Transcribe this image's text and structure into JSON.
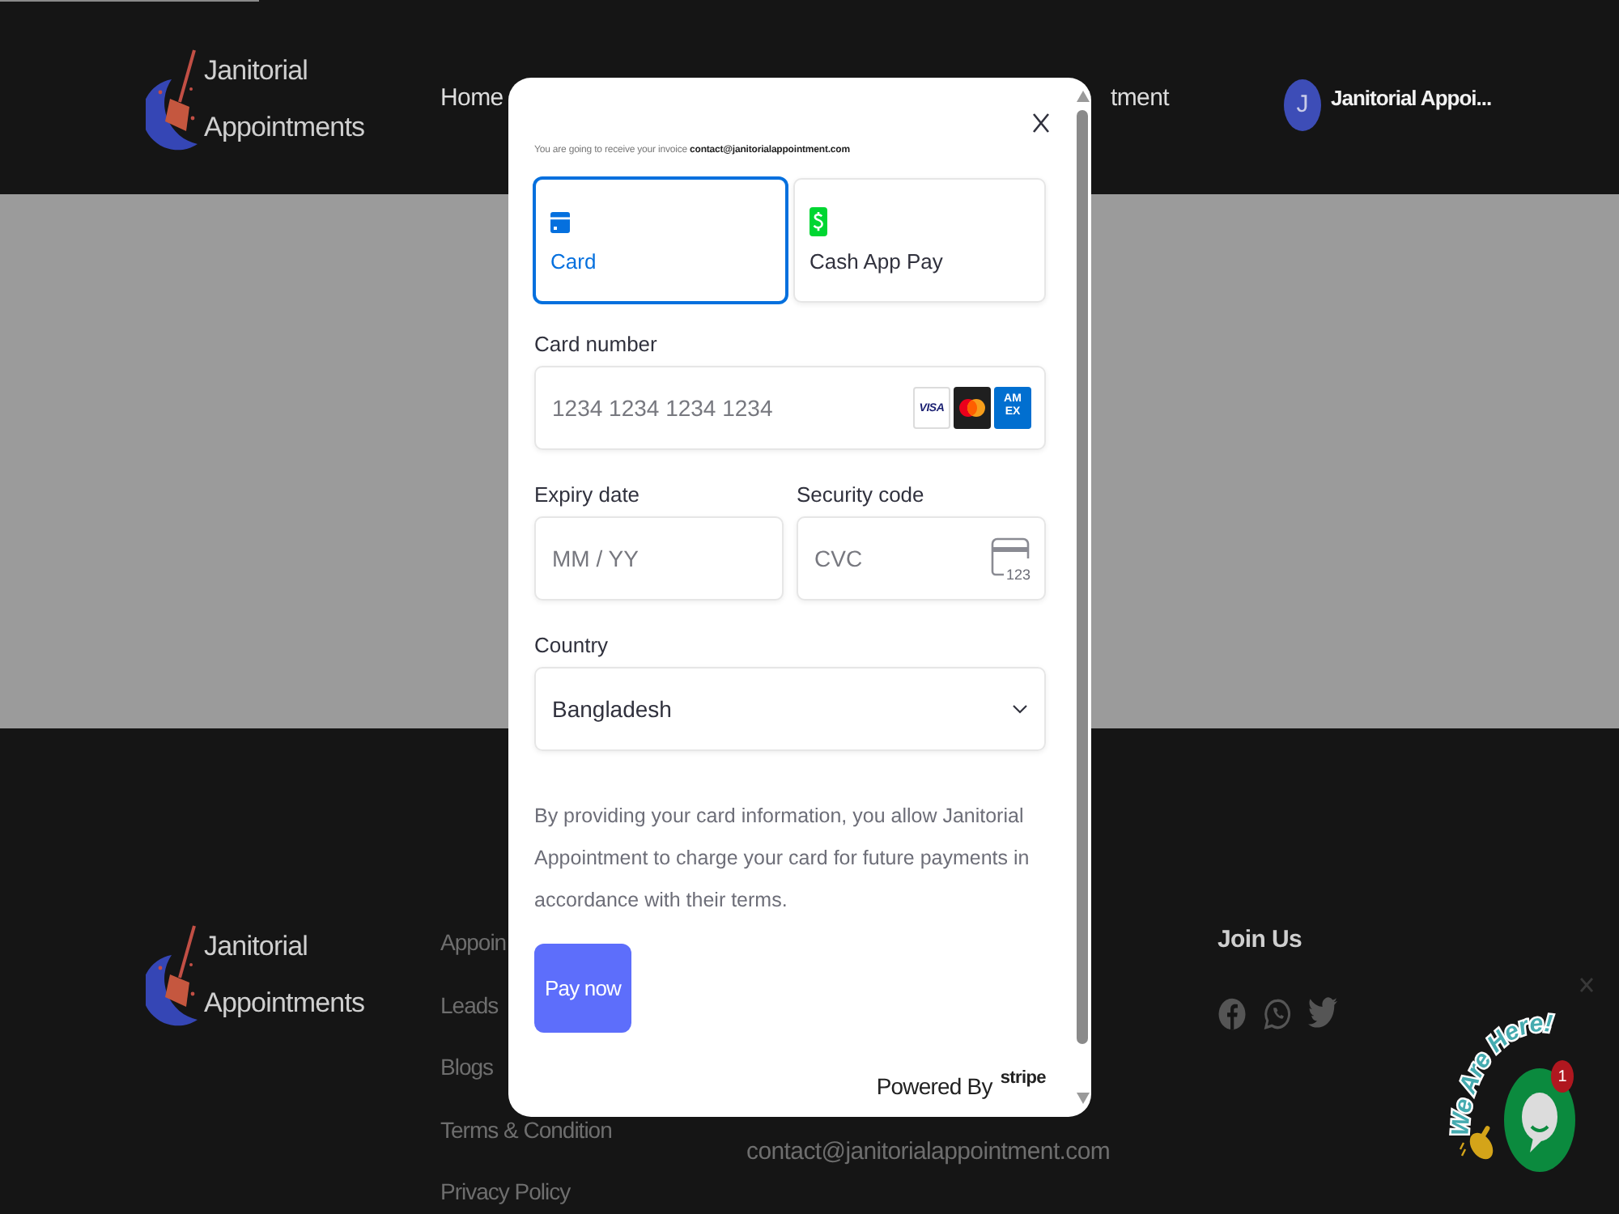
{
  "header": {
    "logo_text": "Janitorial Appointments",
    "nav": [
      {
        "label": "Home"
      },
      {
        "label": "tment"
      }
    ],
    "user": {
      "initial": "J",
      "name": "Janitorial Appoi..."
    }
  },
  "payment_modal": {
    "notice": "You are going to receive your invoice **contact@janitorialappointment.com**",
    "methods": [
      {
        "kind": "card",
        "label": "Card",
        "selected": true
      },
      {
        "kind": "cashapp",
        "label": "Cash App Pay",
        "selected": false
      }
    ],
    "card_number": {
      "label": "Card number",
      "placeholder": "1234 1234 1234 1234",
      "brands": [
        {
          "kind": "visa",
          "label": "VISA"
        },
        {
          "kind": "mastercard"
        },
        {
          "kind": "amex",
          "label": "AMEX"
        }
      ]
    },
    "expiry": {
      "label": "Expiry date",
      "placeholder": "MM / YY"
    },
    "security_code": {
      "label": "Security code",
      "placeholder": "CVC",
      "icon_text": "123"
    },
    "country": {
      "label": "Country",
      "value": "Bangladesh"
    },
    "terms": "By providing your card information, you allow Janitorial Appointment to charge your card for future payments in accordance with their terms.",
    "pay_button": "Pay now",
    "powered_by": "Powered By",
    "provider": "stripe"
  },
  "footer": {
    "logo_text": "Janitorial Appointments",
    "links": [
      "Appoin",
      "Leads",
      "Blogs",
      "Terms & Condition",
      "Privacy Policy"
    ],
    "email": "contact@janitorialappointment.com",
    "social_heading": "Join Us",
    "social": [
      {
        "kind": "facebook"
      },
      {
        "kind": "whatsapp"
      },
      {
        "kind": "twitter"
      }
    ]
  },
  "chat_widget": {
    "banner": "We Are Here!",
    "badge": "1"
  }
}
